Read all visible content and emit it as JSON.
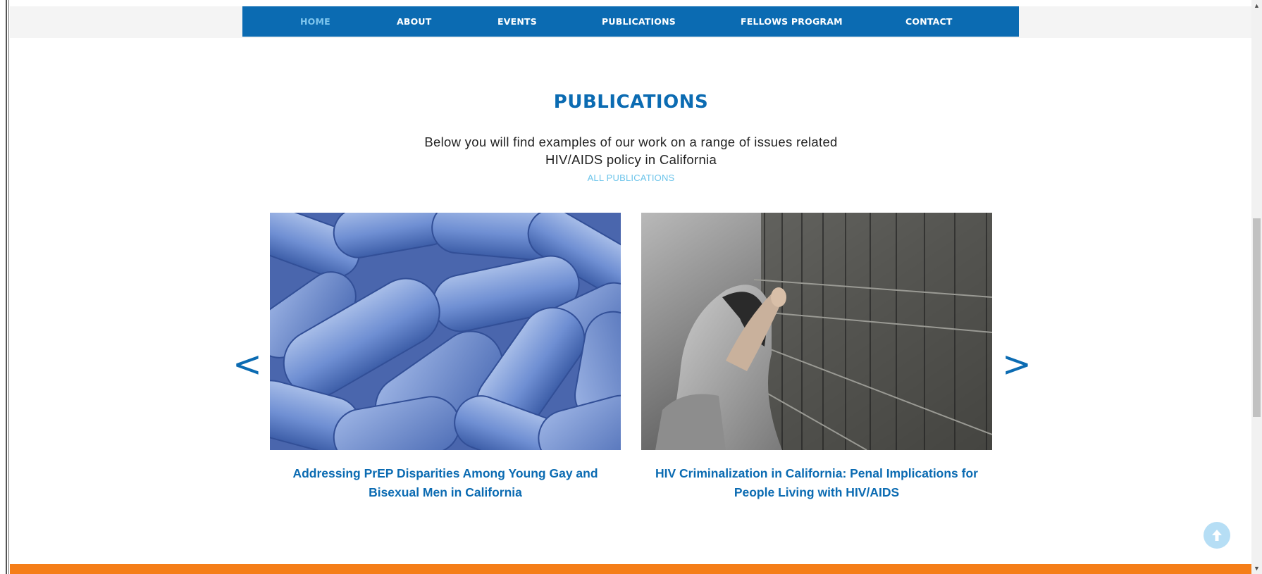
{
  "nav": {
    "items": [
      {
        "label": "HOME",
        "active": true
      },
      {
        "label": "ABOUT"
      },
      {
        "label": "EVENTS"
      },
      {
        "label": "PUBLICATIONS"
      },
      {
        "label": "FELLOWS PROGRAM"
      },
      {
        "label": "CONTACT"
      }
    ]
  },
  "section": {
    "title": "PUBLICATIONS",
    "intro_line1": "Below you will find examples of our work on a range of issues related",
    "intro_line2": "HIV/AIDS policy in California",
    "all_link": "ALL PUBLICATIONS"
  },
  "carousel": {
    "prev": "<",
    "next": ">",
    "cards": [
      {
        "title_line1": "Addressing PrEP Disparities Among Young Gay and",
        "title_line2": "Bisexual Men in California",
        "image": "blue-pills-photo"
      },
      {
        "title_line1": "HIV Criminalization in California: Penal Implications for",
        "title_line2": "People Living with HIV/AIDS",
        "image": "hooded-person-at-fence-photo"
      }
    ]
  },
  "colors": {
    "brand_blue": "#0b6bb2",
    "active_nav": "#7fc6ee",
    "link_light_blue": "#6cc4ea",
    "footer_orange": "#f57e18"
  },
  "icons": {
    "scroll_to_top": "arrow-up-icon"
  }
}
